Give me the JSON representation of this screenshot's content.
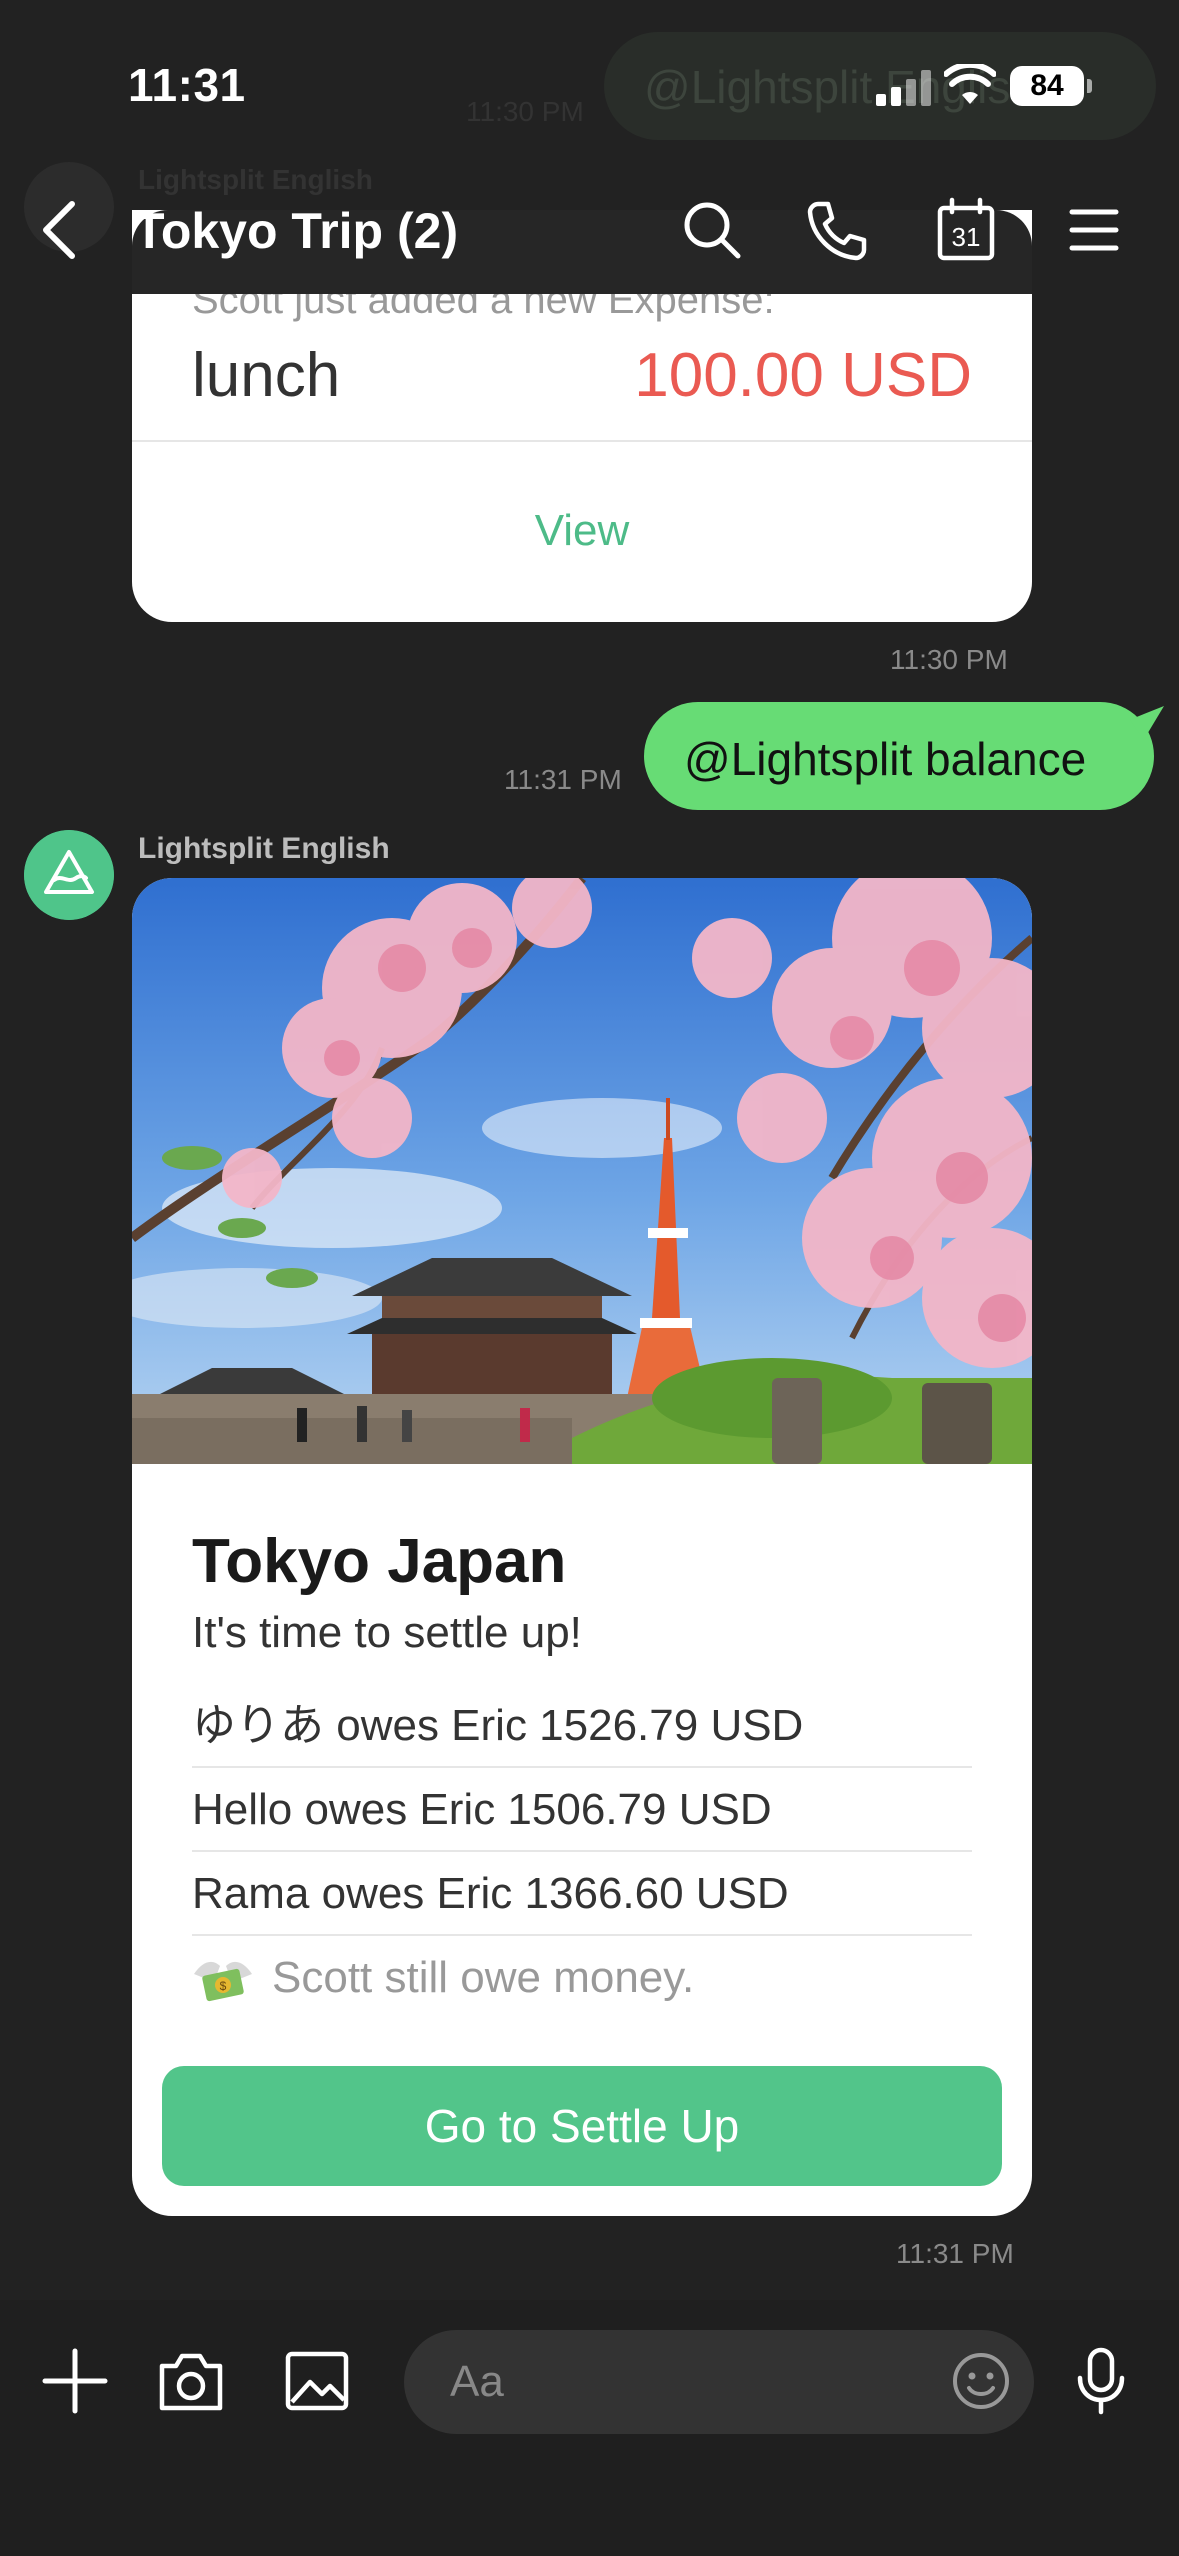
{
  "status_bar": {
    "time": "11:31",
    "battery": "84"
  },
  "ghost": {
    "bubble_text": "@Lightsplit English",
    "time": "11:30 PM",
    "sender": "Lightsplit English"
  },
  "header": {
    "title": "Tokyo Trip (2)",
    "calendar_day": "31"
  },
  "expense_card": {
    "subtitle": "Scott just added a new Expense:",
    "name": "lunch",
    "amount": "100.00 USD",
    "view_label": "View",
    "time": "11:30 PM"
  },
  "outgoing": {
    "text": "@Lightsplit balance",
    "time": "11:31 PM"
  },
  "bot": {
    "name": "Lightsplit English"
  },
  "balance_card": {
    "title": "Tokyo Japan",
    "subtitle": "It's time to settle up!",
    "owes": [
      "ゆりあ owes Eric 1526.79 USD",
      "Hello owes Eric 1506.79 USD",
      "Rama owes Eric 1366.60 USD"
    ],
    "note": "Scott still owe money.",
    "button_label": "Go to Settle Up",
    "time": "11:31 PM"
  },
  "input": {
    "placeholder": "Aa"
  },
  "colors": {
    "accent": "#52c58a",
    "bubble": "#67dc75",
    "amount": "#ea5a52"
  }
}
